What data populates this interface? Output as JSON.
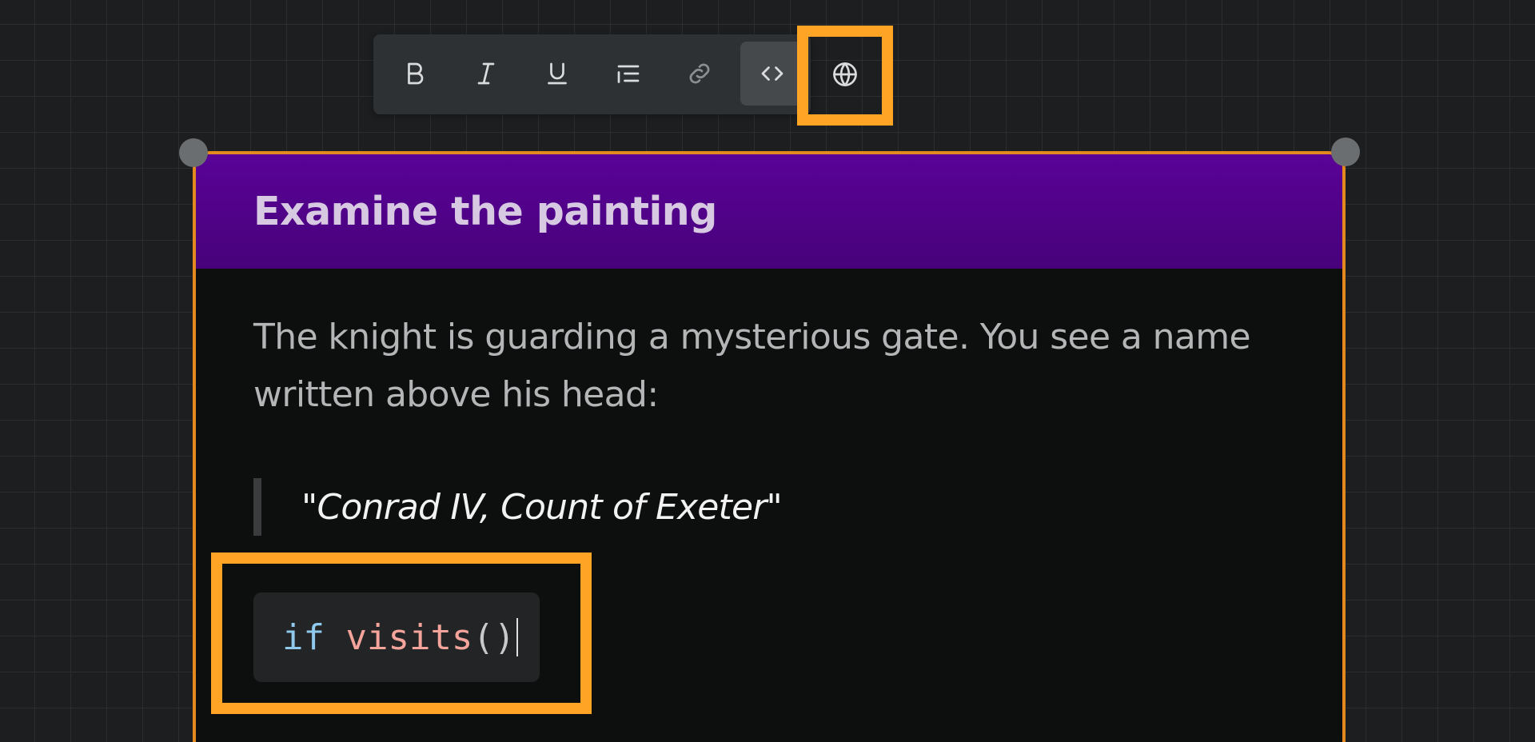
{
  "toolbar": {
    "buttons": [
      {
        "name": "bold",
        "icon": "bold-icon",
        "state": "normal"
      },
      {
        "name": "italic",
        "icon": "italic-icon",
        "state": "normal"
      },
      {
        "name": "underline",
        "icon": "underline-icon",
        "state": "normal"
      },
      {
        "name": "list",
        "icon": "list-icon",
        "state": "normal"
      },
      {
        "name": "link",
        "icon": "link-icon",
        "state": "disabled"
      },
      {
        "name": "code",
        "icon": "code-icon",
        "state": "active"
      },
      {
        "name": "globe",
        "icon": "globe-icon",
        "state": "highlighted"
      }
    ]
  },
  "card": {
    "title": "Examine the painting",
    "body_text": "The knight is guarding a mysterious gate. You see a name written above his head:",
    "quote": "\"Conrad IV, Count of Exeter\"",
    "code": {
      "keyword": "if",
      "function": "visits",
      "parens": "()"
    }
  },
  "colors": {
    "accent_highlight": "#ffa424",
    "card_border": "#e4891e",
    "header_purple": "#5a0297",
    "background": "#1c1e20"
  }
}
